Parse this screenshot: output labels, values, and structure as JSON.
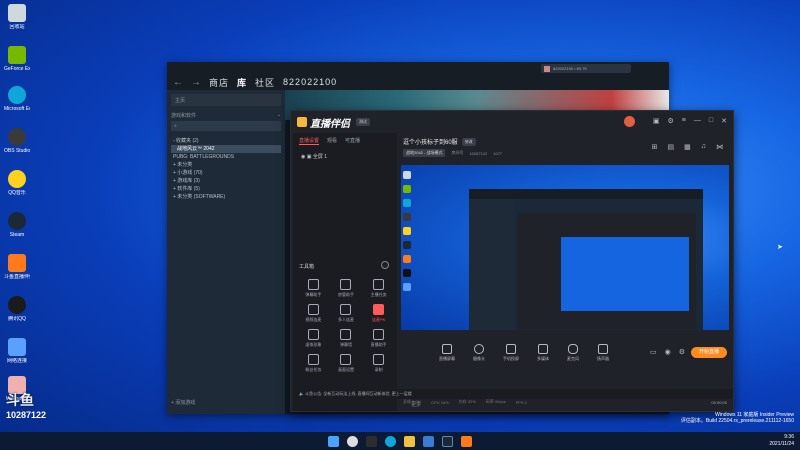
{
  "desktop_icons": [
    {
      "label": "回收站",
      "color": "#cfd8dc"
    },
    {
      "label": "GeForce Experience",
      "color": "#76b900"
    },
    {
      "label": "Microsoft Edge",
      "color": "#0fa7d8"
    },
    {
      "label": "OBS Studio",
      "color": "#3a3a3a"
    },
    {
      "label": "QQ音乐",
      "color": "#ffd21e"
    },
    {
      "label": "Steam",
      "color": "#1b2838"
    },
    {
      "label": "斗鱼直播伴侣",
      "color": "#ff7a1a"
    },
    {
      "label": "腾讯QQ",
      "color": "#1b1b1b"
    },
    {
      "label": "网络连接",
      "color": "#5aa0ff"
    },
    {
      "label": "Wallpaper",
      "color": "#f0b0b0"
    }
  ],
  "steam": {
    "nav": {
      "back": "←",
      "forward": "→",
      "store": "商店",
      "library": "库",
      "community": "社区",
      "user_id": "822022100"
    },
    "user_box": "822022100 • ¥0.75",
    "side": {
      "home": "主页",
      "filter_label": "游戏和软件",
      "search_placeholder": "",
      "items": [
        "- 收藏夹 (2)",
        "战地风云™ 2042",
        "PUBG: BATTLEGROUNDS",
        "+ 未分类",
        "+ 小游戏 (70)",
        "+ 游戏库 (3)",
        "+ 软件库 (5)",
        "+ 未分类 (SOFTWARE)"
      ],
      "selected_index": 1,
      "add_game": "+ 添加游戏"
    }
  },
  "stream_app": {
    "logo": "直播伴侣",
    "version_badge": "测试",
    "left_tabs": [
      "直播设置",
      "观看",
      "可直播"
    ],
    "scene": "◉ ▣ 全屏 1",
    "tools_title": "工具箱",
    "tools": [
      {
        "label": "弹幕助手",
        "hot": false
      },
      {
        "label": "房管助手",
        "hot": false
      },
      {
        "label": "主播任务",
        "hot": false
      },
      {
        "label": "视频连麦",
        "hot": false
      },
      {
        "label": "多人连麦",
        "hot": false
      },
      {
        "label": "连麦PK",
        "hot": true
      },
      {
        "label": "虚拟形象",
        "hot": false
      },
      {
        "label": "弹幕墙",
        "hot": false
      },
      {
        "label": "直播助手",
        "hot": false
      },
      {
        "label": "粉丝任务",
        "hot": false
      },
      {
        "label": "画面设置",
        "hot": false
      },
      {
        "label": "录制",
        "hot": false
      }
    ],
    "tip": "斗鱼公告: 全新互动玩法上线, 直播间互动新体验, 更上一层楼",
    "bottom_label": "更多",
    "room_title": "逗个小孩标子到60服",
    "room_edit": "修改",
    "room_meta": {
      "tag": "战地2042 - 战场模式",
      "room_label": "房间号",
      "room_id": "10287122",
      "online": "1077"
    },
    "controls": [
      "直播屏幕",
      "摄像头",
      "手机投屏",
      "多媒体",
      "麦克风",
      "扬声器"
    ],
    "start_button": "开始直播",
    "stats": [
      "丢帧 0.0%",
      "CPU 16%",
      "内存 32%",
      "码率 0kbps",
      "FPS 0"
    ],
    "time": "00:00:00"
  },
  "watermark": {
    "logo": "斗鱼",
    "room_id": "10287122"
  },
  "win11_build": {
    "line1": "Windows 11 家庭版 Insider Preview",
    "line2": "评估副本。Build 22504.rs_prerelease.211112-1650"
  },
  "clock": {
    "time": "9:36",
    "date": "2021/11/24"
  },
  "taskbar_icons": [
    "windows",
    "search",
    "files",
    "edge",
    "folder",
    "store",
    "steam",
    "douyu"
  ]
}
